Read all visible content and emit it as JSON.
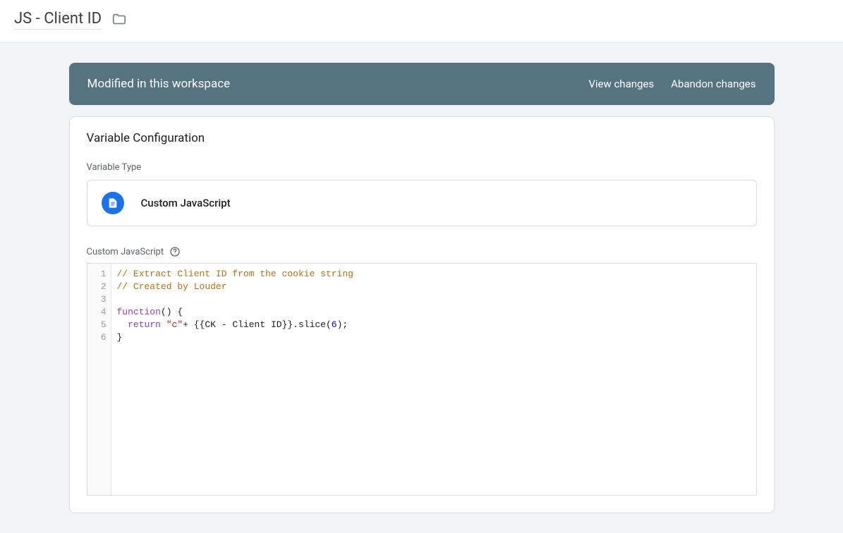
{
  "header": {
    "title": "JS - Client ID"
  },
  "banner": {
    "message": "Modified in this workspace",
    "view_changes": "View changes",
    "abandon_changes": "Abandon changes"
  },
  "config": {
    "card_title": "Variable Configuration",
    "type_label": "Variable Type",
    "type_value": "Custom JavaScript",
    "code_label": "Custom JavaScript"
  },
  "code": {
    "line_numbers": [
      "1",
      "2",
      "3",
      "4",
      "5",
      "6"
    ],
    "lines": {
      "l1_comment": "// Extract Client ID from the cookie string",
      "l2_comment": "// Created by Louder",
      "l3": "",
      "l4_kw": "function",
      "l4_rest": "() {",
      "l5_indent": "  ",
      "l5_kw": "return",
      "l5_sp1": " ",
      "l5_str": "\"c\"",
      "l5_rest_a": "+ {{CK - Client ID}}.slice(",
      "l5_num": "6",
      "l5_rest_b": ");",
      "l6": "}"
    }
  }
}
